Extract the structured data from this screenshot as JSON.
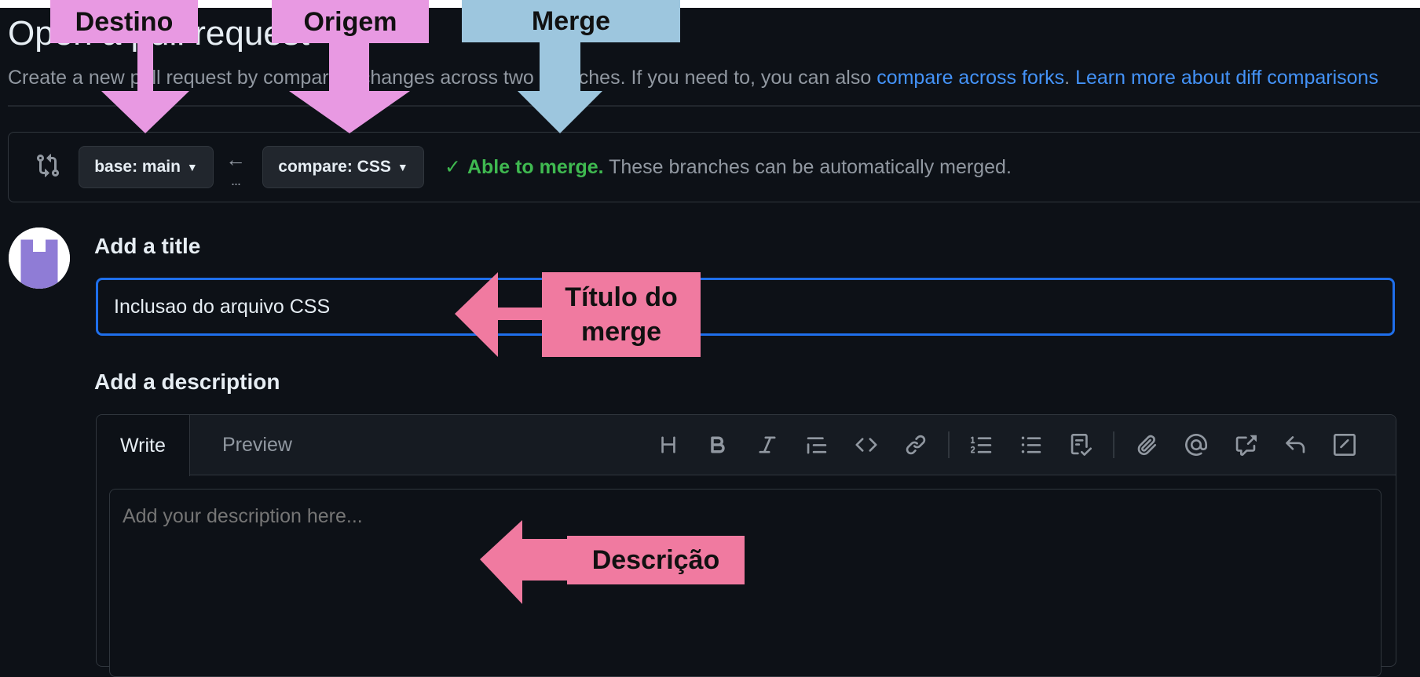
{
  "page": {
    "title": "Open a pull request",
    "subtitle_start": "Create a new pull request by comparing changes across two branches. If you need to, you can also ",
    "link_forks": "compare across forks",
    "subtitle_mid": ". ",
    "link_diff": "Learn more about diff comparisons"
  },
  "compare": {
    "base_label": "base: main",
    "compare_label": "compare: CSS",
    "arrow": "←",
    "dots": "...",
    "check": "✓",
    "status_ok": "Able to merge.",
    "status_text": " These branches can be automatically merged."
  },
  "form": {
    "title_label": "Add a title",
    "title_value": "Inclusao do arquivo CSS",
    "description_label": "Add a description",
    "tab_write": "Write",
    "tab_preview": "Preview",
    "description_placeholder": "Add your description here..."
  },
  "toolbar_icons": [
    "heading-icon",
    "bold-icon",
    "italic-icon",
    "quote-icon",
    "code-icon",
    "link-icon",
    "numbered-list-icon",
    "unordered-list-icon",
    "task-list-icon",
    "attach-icon",
    "mention-icon",
    "cross-reference-icon",
    "reply-icon",
    "slash-command-icon"
  ],
  "annotations": {
    "destino": "Destino",
    "origem": "Origem",
    "merge": "Merge",
    "titulo": "Título do merge",
    "descricao": "Descrição"
  },
  "colors": {
    "background": "#0d1117",
    "accent_blue": "#4493f8",
    "focus_blue": "#1f6feb",
    "success_green": "#3fb950",
    "annotation_purple": "#e899e2",
    "annotation_blue": "#9dc6de",
    "annotation_pink": "#f07aa0"
  }
}
